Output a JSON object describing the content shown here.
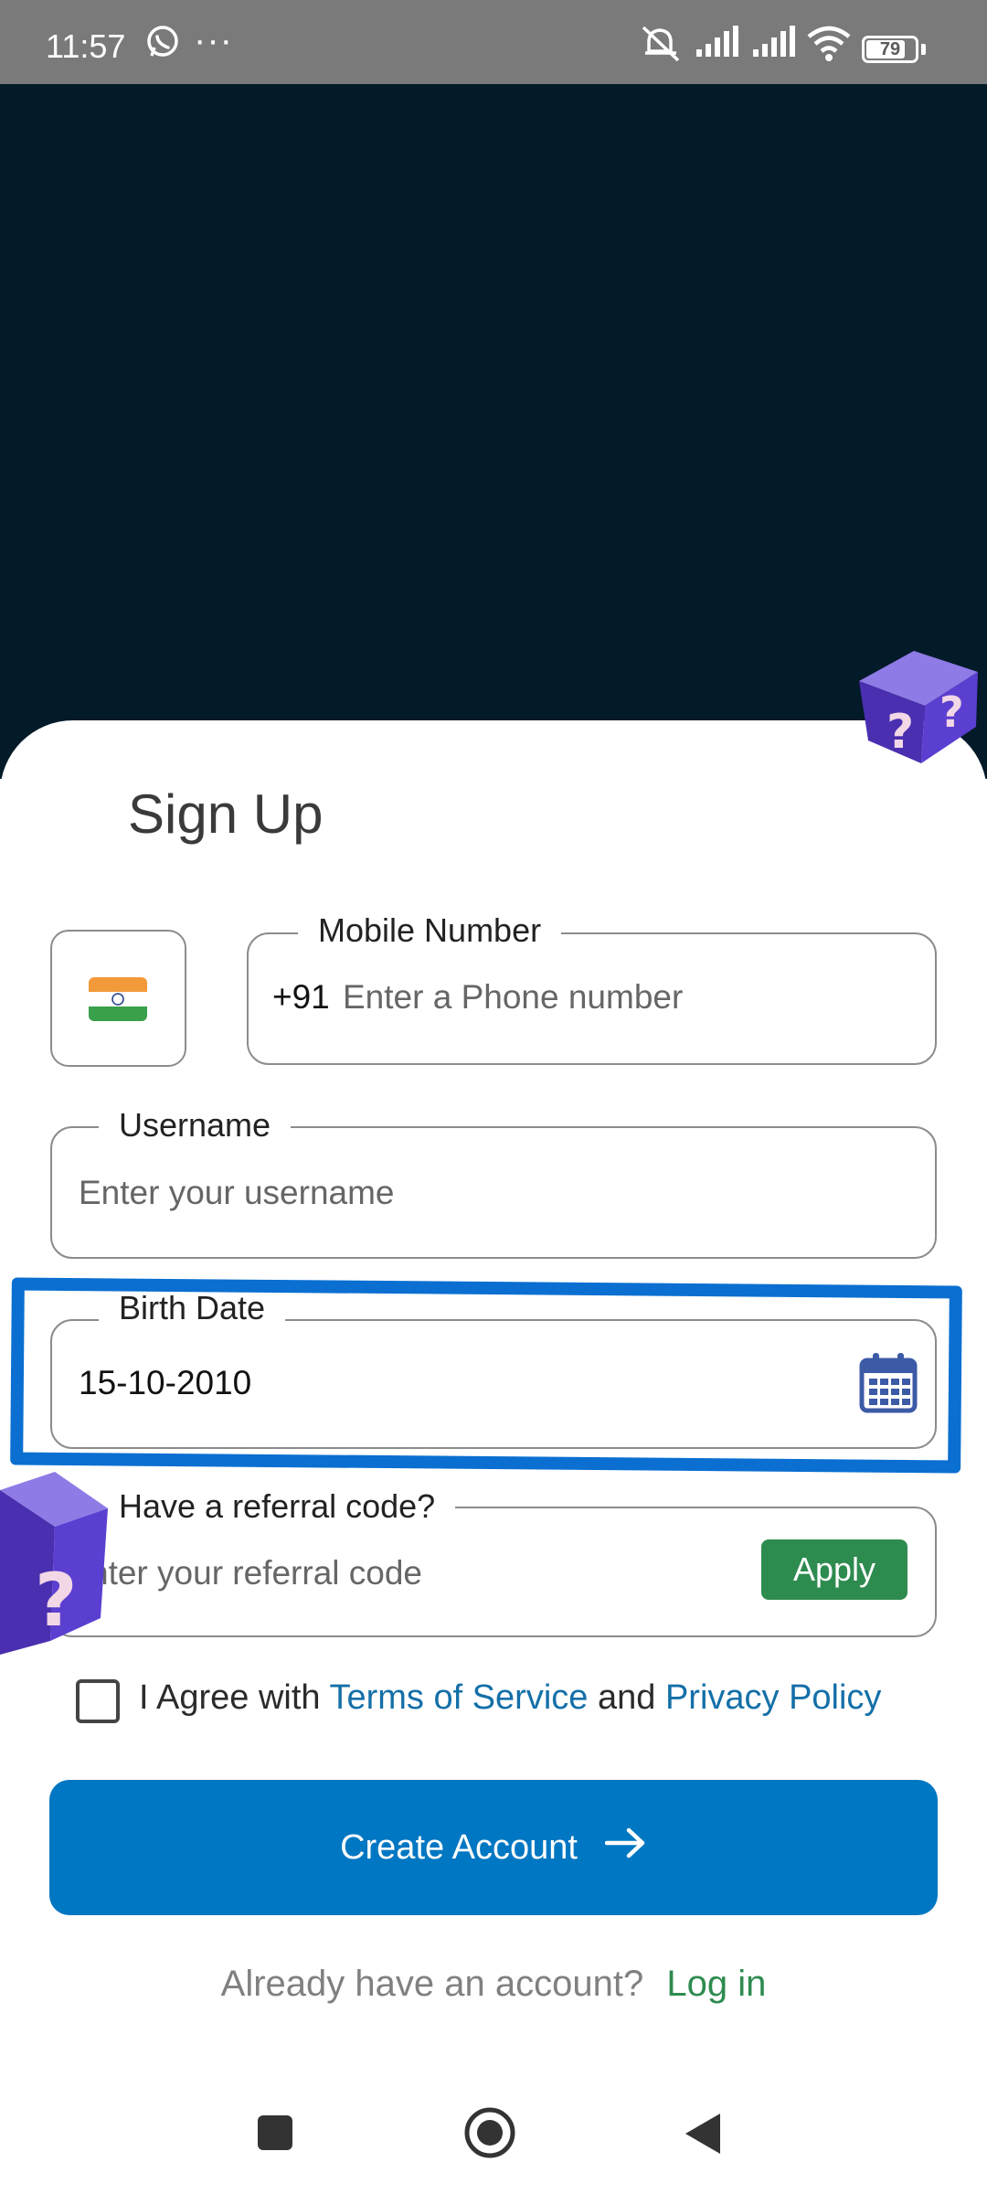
{
  "status_bar": {
    "time": "11:57",
    "more": "···",
    "battery": "79",
    "icons": [
      "whatsapp-icon",
      "mute-icon",
      "signal-icon",
      "signal-icon",
      "wifi-icon",
      "battery-icon"
    ]
  },
  "form": {
    "title": "Sign Up",
    "country_flag": "india-flag-icon",
    "mobile": {
      "label": "Mobile Number",
      "prefix": "+91",
      "placeholder": "Enter a Phone number"
    },
    "username": {
      "label": "Username",
      "placeholder": "Enter your username"
    },
    "birth_date": {
      "label": "Birth Date",
      "value": "15-10-2010",
      "icon": "calendar-icon"
    },
    "referral": {
      "label": "Have a referral code?",
      "placeholder": "nter your referral code",
      "apply_label": "Apply"
    },
    "agree": {
      "prefix": "I Agree with",
      "terms": "Terms of Service",
      "and": "and",
      "privacy": "Privacy Policy"
    },
    "create_label": "Create Account",
    "login_prompt": "Already have an account?",
    "login_link": "Log in"
  },
  "colors": {
    "dark_background": "#031a29",
    "primary_blue": "#0077c2",
    "green": "#2e8b4f",
    "highlight": "#0a6fd1"
  }
}
